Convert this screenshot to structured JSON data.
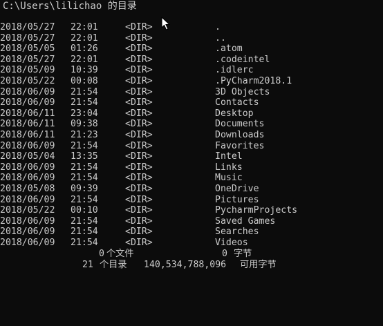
{
  "header": {
    "path": "C:\\Users\\lilichao 的目录"
  },
  "entries": [
    {
      "date": "2018/05/27",
      "time": "22:01",
      "type": "<DIR>",
      "name": "."
    },
    {
      "date": "2018/05/27",
      "time": "22:01",
      "type": "<DIR>",
      "name": ".."
    },
    {
      "date": "2018/05/05",
      "time": "01:26",
      "type": "<DIR>",
      "name": ".atom"
    },
    {
      "date": "2018/05/27",
      "time": "22:01",
      "type": "<DIR>",
      "name": ".codeintel"
    },
    {
      "date": "2018/05/09",
      "time": "10:39",
      "type": "<DIR>",
      "name": ".idlerc"
    },
    {
      "date": "2018/05/22",
      "time": "00:08",
      "type": "<DIR>",
      "name": ".PyCharm2018.1"
    },
    {
      "date": "2018/06/09",
      "time": "21:54",
      "type": "<DIR>",
      "name": "3D Objects"
    },
    {
      "date": "2018/06/09",
      "time": "21:54",
      "type": "<DIR>",
      "name": "Contacts"
    },
    {
      "date": "2018/06/11",
      "time": "23:04",
      "type": "<DIR>",
      "name": "Desktop"
    },
    {
      "date": "2018/06/11",
      "time": "09:38",
      "type": "<DIR>",
      "name": "Documents"
    },
    {
      "date": "2018/06/11",
      "time": "21:23",
      "type": "<DIR>",
      "name": "Downloads"
    },
    {
      "date": "2018/06/09",
      "time": "21:54",
      "type": "<DIR>",
      "name": "Favorites"
    },
    {
      "date": "2018/05/04",
      "time": "13:35",
      "type": "<DIR>",
      "name": "Intel"
    },
    {
      "date": "2018/06/09",
      "time": "21:54",
      "type": "<DIR>",
      "name": "Links"
    },
    {
      "date": "2018/06/09",
      "time": "21:54",
      "type": "<DIR>",
      "name": "Music"
    },
    {
      "date": "2018/05/08",
      "time": "09:39",
      "type": "<DIR>",
      "name": "OneDrive"
    },
    {
      "date": "2018/06/09",
      "time": "21:54",
      "type": "<DIR>",
      "name": "Pictures"
    },
    {
      "date": "2018/05/22",
      "time": "00:10",
      "type": "<DIR>",
      "name": "PycharmProjects"
    },
    {
      "date": "2018/06/09",
      "time": "21:54",
      "type": "<DIR>",
      "name": "Saved Games"
    },
    {
      "date": "2018/06/09",
      "time": "21:54",
      "type": "<DIR>",
      "name": "Searches"
    },
    {
      "date": "2018/06/09",
      "time": "21:54",
      "type": "<DIR>",
      "name": "Videos"
    }
  ],
  "summary": {
    "files_count": "0",
    "files_label": "个文件",
    "files_bytes": "0",
    "files_unit": "字节",
    "dirs_count": "21",
    "dirs_label": "个目录",
    "dirs_bytes": "140,534,788,096",
    "dirs_unit": "可用字节"
  },
  "colors": {
    "background": "#0c0c0c",
    "foreground": "#cccccc"
  },
  "icons": {
    "cursor": "mouse-pointer-icon"
  }
}
